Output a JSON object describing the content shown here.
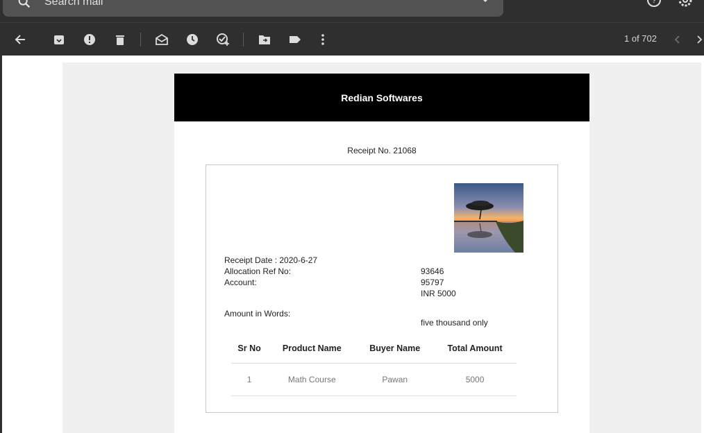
{
  "search": {
    "placeholder": "Search mail"
  },
  "toolbar": {
    "back": "back-arrow-icon",
    "archive": "archive-icon",
    "report": "report-spam-icon",
    "delete": "delete-icon",
    "mark_unread": "mark-unread-icon",
    "snooze": "snooze-icon",
    "add_task": "add-task-icon",
    "move": "move-to-icon",
    "label": "label-icon",
    "more": "more-vertical-icon",
    "pager": "1 of 702"
  },
  "email": {
    "company": "Redian Softwares",
    "receipt_no": "Receipt No. 21068",
    "receipt_date": "Receipt Date : 2020-6-27",
    "allocation_label": "Allocation Ref No:",
    "allocation_value": "93646",
    "account_label": "Account:",
    "account_value": "95797",
    "amount_value": "INR 5000",
    "amount_words_label": "Amount in Words:",
    "amount_words_value": "five thousand only",
    "table": {
      "headers": [
        "Sr No",
        "Product Name",
        "Buyer Name",
        "Total Amount"
      ],
      "rows": [
        [
          "1",
          "Math Course",
          "Pawan",
          "5000"
        ]
      ]
    }
  },
  "colors": {
    "toolbar_bg": "#2f2f2f",
    "header_bg": "#000000",
    "canvas_bg": "#f0f0f0"
  }
}
